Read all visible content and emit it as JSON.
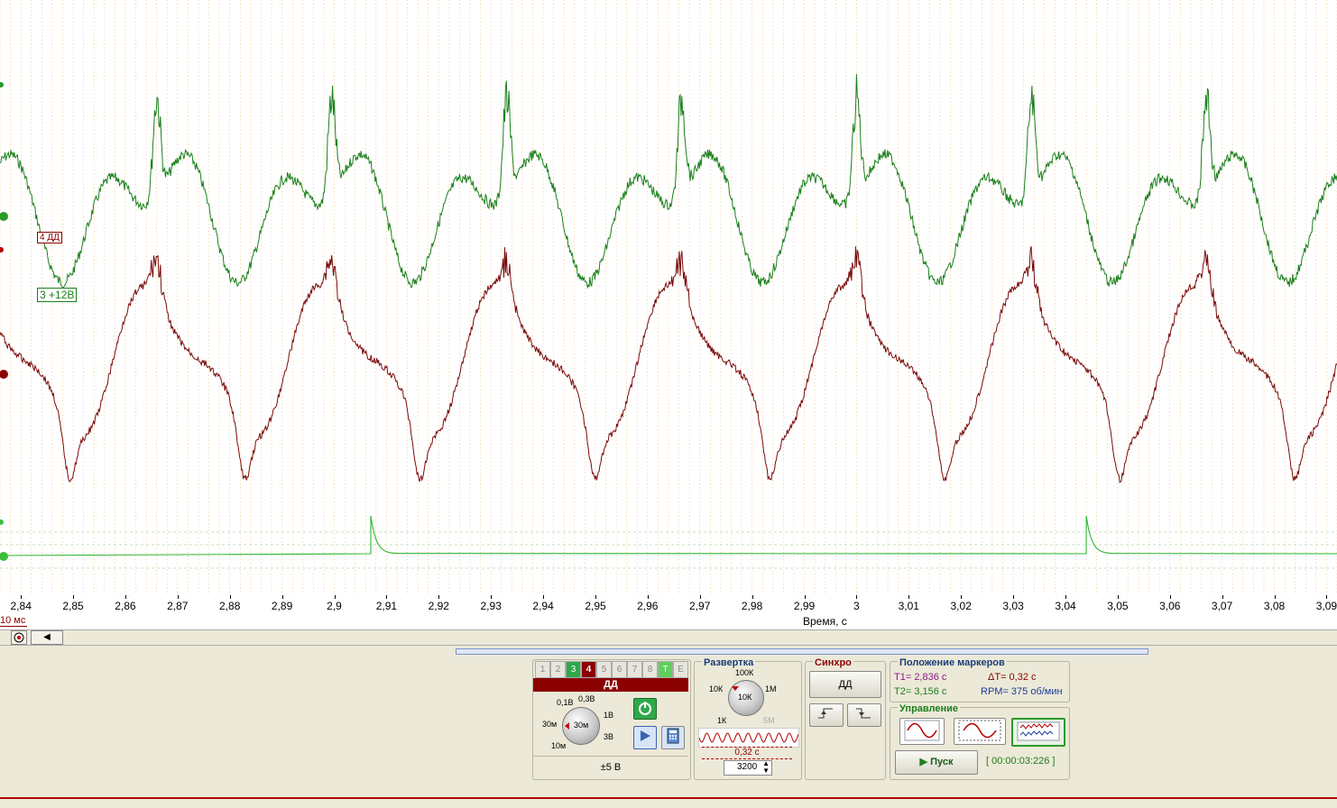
{
  "scope": {
    "x_ticks": [
      "2,84",
      "2,85",
      "2,86",
      "2,87",
      "2,88",
      "2,89",
      "2,9",
      "2,91",
      "2,92",
      "2,93",
      "2,94",
      "2,95",
      "2,96",
      "2,97",
      "2,98",
      "2,99",
      "3",
      "3,01",
      "3,02",
      "3,03",
      "3,04",
      "3,05",
      "3,06",
      "3,07",
      "3,08",
      "3,09"
    ],
    "x_axis_title": "Время, с",
    "division_label": "10 мс",
    "channel_labels": {
      "ch4": "4 ДД",
      "ch3": "3 +12В"
    },
    "colors": {
      "ch3": "#1a7f1a",
      "ch4": "#7a0a0a",
      "sync": "#2db52d",
      "grid": "#f0a030",
      "grid_h": "#aaddaa"
    }
  },
  "chart_data": {
    "type": "line",
    "xlabel": "Время, с",
    "x_range": [
      2.836,
      3.092
    ],
    "series": [
      {
        "name": "3 +12В",
        "color": "#1a7f1a",
        "shape": "periodic waveform with ~0.0335 s period, sharp peaks near 2.866, 2.899, 2.933, 2.967, 3.0, 3.034, 3.068"
      },
      {
        "name": "4 ДД",
        "color": "#7a0a0a",
        "shape": "periodic waveform with ~0.0335 s period, troughs near 2.849, 2.882, 2.916, 2.95, 2.984, 3.02, 3.053, 3.088"
      },
      {
        "name": "sync",
        "color": "#2db52d",
        "pulses_at": [
          2.907,
          3.044
        ]
      }
    ]
  },
  "scrollbar": {
    "add_icon": "add-channel-icon",
    "left_icon": "arrow-left-icon"
  },
  "channels": {
    "buttons": [
      "1",
      "2",
      "3",
      "4",
      "5",
      "6",
      "7",
      "8",
      "T",
      "E"
    ],
    "active": "4",
    "selected_name": "ДД",
    "range_labels": [
      "0,1В",
      "0,3В",
      "1В",
      "3В",
      "30м",
      "10м"
    ],
    "knob_value": "30м",
    "range_display": "±5 В"
  },
  "sweep": {
    "title": "Развертка",
    "knob_labels": [
      "100К",
      "10К",
      "1М",
      "1К",
      "5М"
    ],
    "knob_value": "10К",
    "time_label": "0,32 с",
    "samples": "3200"
  },
  "sync": {
    "title": "Синхро",
    "source": "ДД"
  },
  "markers": {
    "title": "Положение маркеров",
    "t1": "T1= 2,836 с",
    "dt": "ΔT= 0,32 с",
    "t2": "T2= 3,156 с",
    "rpm": "RPM= 375 об/мин"
  },
  "control": {
    "title": "Управление",
    "start_label": "Пуск",
    "timer": "[ 00:00:03:226 ]"
  }
}
